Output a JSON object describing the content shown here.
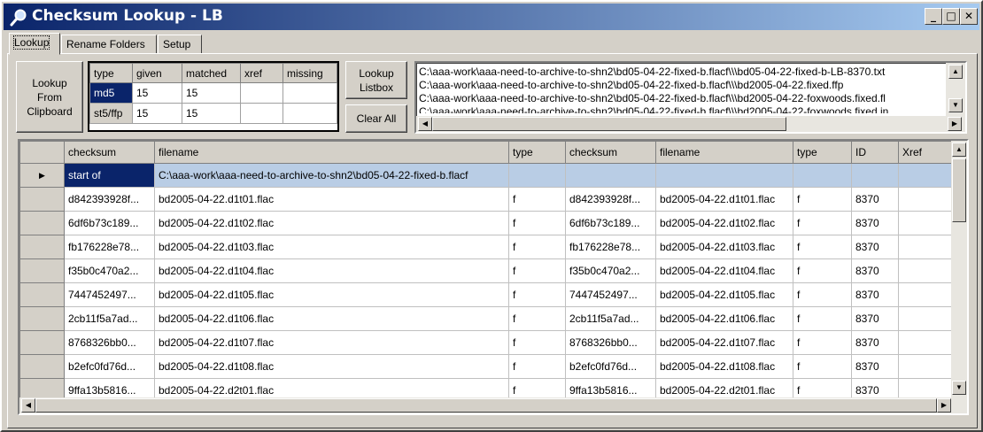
{
  "window": {
    "title": "Checksum Lookup - LB",
    "controls": {
      "minimize": "_",
      "maximize": "□",
      "close": "✕"
    }
  },
  "tabs": [
    "Lookup",
    "Rename Folders",
    "Setup"
  ],
  "buttons": {
    "lookup_clipboard": "Lookup\nFrom\nClipboard",
    "lookup_listbox": "Lookup\nListbox",
    "clear_all": "Clear All"
  },
  "summary": {
    "columns": [
      "type",
      "given",
      "matched",
      "xref",
      "missing"
    ],
    "rows": [
      [
        "md5",
        "15",
        "15",
        "",
        ""
      ],
      [
        "st5/ffp",
        "15",
        "15",
        "",
        ""
      ]
    ]
  },
  "listbox": {
    "lines": [
      "C:\\aaa-work\\aaa-need-to-archive-to-shn2\\bd05-04-22-fixed-b.flacf\\\\\\bd05-04-22-fixed-b-LB-8370.txt",
      "C:\\aaa-work\\aaa-need-to-archive-to-shn2\\bd05-04-22-fixed-b.flacf\\\\\\bd2005-04-22.fixed.ffp",
      "C:\\aaa-work\\aaa-need-to-archive-to-shn2\\bd05-04-22-fixed-b.flacf\\\\\\bd2005-04-22-foxwoods.fixed.fl",
      "C:\\aaa-work\\aaa-need-to-archive-to-shn2\\bd05-04-22-fixed-b.flacf\\\\\\bd2005-04-22-foxwoods.fixed.in"
    ]
  },
  "grid": {
    "columns": [
      "checksum",
      "filename",
      "type",
      "checksum",
      "filename",
      "type",
      "ID",
      "Xref"
    ],
    "rows": [
      [
        "start of",
        "C:\\aaa-work\\aaa-need-to-archive-to-shn2\\bd05-04-22-fixed-b.flacf",
        "",
        "",
        "",
        "",
        "",
        ""
      ],
      [
        "d842393928f...",
        "bd2005-04-22.d1t01.flac",
        "f",
        "d842393928f...",
        "bd2005-04-22.d1t01.flac",
        "f",
        "8370",
        ""
      ],
      [
        "6df6b73c189...",
        "bd2005-04-22.d1t02.flac",
        "f",
        "6df6b73c189...",
        "bd2005-04-22.d1t02.flac",
        "f",
        "8370",
        ""
      ],
      [
        "fb176228e78...",
        "bd2005-04-22.d1t03.flac",
        "f",
        "fb176228e78...",
        "bd2005-04-22.d1t03.flac",
        "f",
        "8370",
        ""
      ],
      [
        "f35b0c470a2...",
        "bd2005-04-22.d1t04.flac",
        "f",
        "f35b0c470a2...",
        "bd2005-04-22.d1t04.flac",
        "f",
        "8370",
        ""
      ],
      [
        "7447452497...",
        "bd2005-04-22.d1t05.flac",
        "f",
        "7447452497...",
        "bd2005-04-22.d1t05.flac",
        "f",
        "8370",
        ""
      ],
      [
        "2cb11f5a7ad...",
        "bd2005-04-22.d1t06.flac",
        "f",
        "2cb11f5a7ad...",
        "bd2005-04-22.d1t06.flac",
        "f",
        "8370",
        ""
      ],
      [
        "8768326bb0...",
        "bd2005-04-22.d1t07.flac",
        "f",
        "8768326bb0...",
        "bd2005-04-22.d1t07.flac",
        "f",
        "8370",
        ""
      ],
      [
        "b2efc0fd76d...",
        "bd2005-04-22.d1t08.flac",
        "f",
        "b2efc0fd76d...",
        "bd2005-04-22.d1t08.flac",
        "f",
        "8370",
        ""
      ],
      [
        "9ffa13b5816...",
        "bd2005-04-22.d2t01.flac",
        "f",
        "9ffa13b5816...",
        "bd2005-04-22.d2t01.flac",
        "f",
        "8370",
        ""
      ]
    ]
  }
}
